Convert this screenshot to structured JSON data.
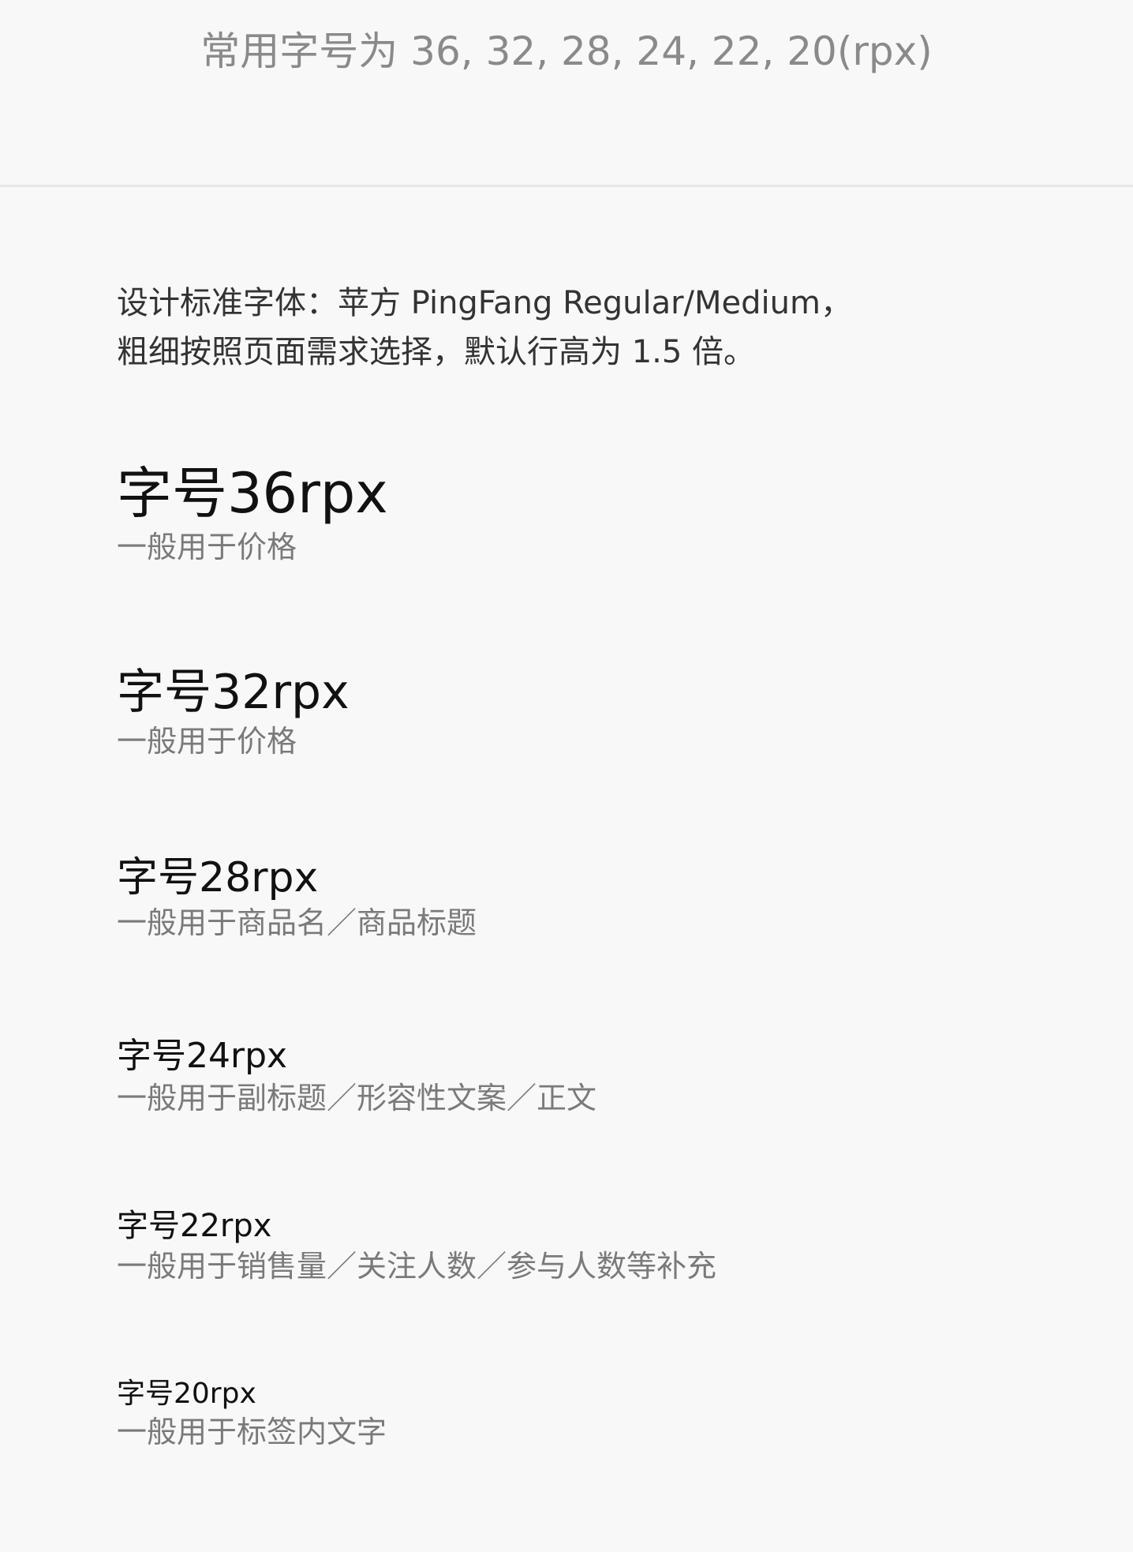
{
  "header": {
    "title": "常用字号为 36, 32, 28, 24, 22, 20(rpx)"
  },
  "intro": {
    "line1": "设计标准字体：苹方 PingFang Regular/Medium，",
    "line2": "粗细按照页面需求选择，默认行高为 1.5 倍。"
  },
  "samples": [
    {
      "title": "字号36rpx",
      "desc": "一般用于价格"
    },
    {
      "title": "字号32rpx",
      "desc": "一般用于价格"
    },
    {
      "title": "字号28rpx",
      "desc": "一般用于商品名／商品标题"
    },
    {
      "title": "字号24rpx",
      "desc": "一般用于副标题／形容性文案／正文"
    },
    {
      "title": "字号22rpx",
      "desc": "一般用于销售量／关注人数／参与人数等补充"
    },
    {
      "title": "字号20rpx",
      "desc": "一般用于标签内文字"
    }
  ]
}
